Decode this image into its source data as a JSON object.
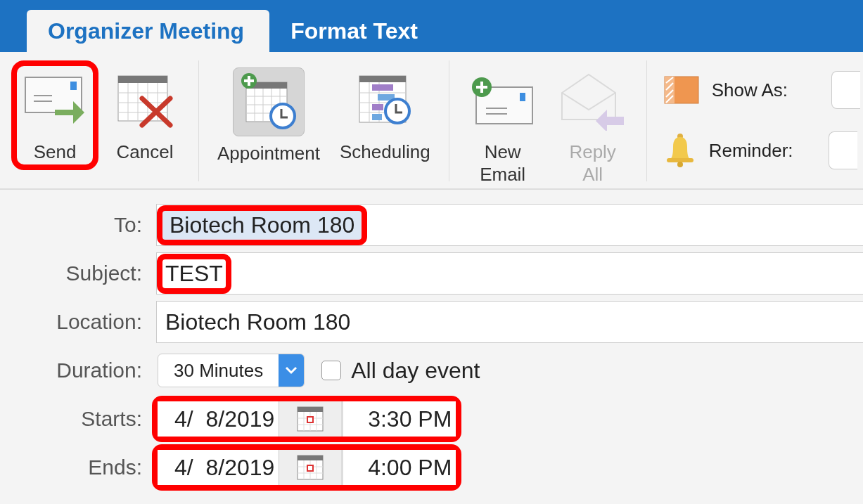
{
  "tabs": [
    {
      "label": "Organizer Meeting",
      "selected": true
    },
    {
      "label": "Format Text",
      "selected": false
    }
  ],
  "ribbon": {
    "groups": [
      [
        {
          "kind": "send",
          "label": "Send",
          "highlighted": true,
          "disabled": false,
          "pressed": false
        },
        {
          "kind": "cancel",
          "label": "Cancel",
          "highlighted": false,
          "disabled": false,
          "pressed": false
        }
      ],
      [
        {
          "kind": "appointment",
          "label": "Appointment",
          "highlighted": false,
          "disabled": false,
          "pressed": true
        },
        {
          "kind": "scheduling",
          "label": "Scheduling",
          "highlighted": false,
          "disabled": false,
          "pressed": false
        }
      ],
      [
        {
          "kind": "new_email",
          "label": "New Email",
          "highlighted": false,
          "disabled": false,
          "pressed": false
        },
        {
          "kind": "reply_all",
          "label": "Reply All",
          "highlighted": false,
          "disabled": true,
          "pressed": false
        }
      ]
    ],
    "options": [
      {
        "kind": "show_as",
        "label": "Show As:"
      },
      {
        "kind": "reminder",
        "label": "Reminder:"
      }
    ]
  },
  "form": {
    "to": {
      "label": "To:",
      "value": "Biotech Room 180",
      "highlighted": true
    },
    "subject": {
      "label": "Subject:",
      "value": "TEST",
      "highlighted": true
    },
    "location": {
      "label": "Location:",
      "value": "Biotech Room 180",
      "highlighted": false
    },
    "duration": {
      "label": "Duration:",
      "value": "30 Minutes"
    },
    "all_day": {
      "label": "All day event",
      "checked": false
    },
    "starts": {
      "label": "Starts:",
      "date": "4/  8/2019",
      "time": "3:30 PM",
      "highlighted": true
    },
    "ends": {
      "label": "Ends:",
      "date": "4/  8/2019",
      "time": "4:00 PM",
      "highlighted": true
    }
  }
}
